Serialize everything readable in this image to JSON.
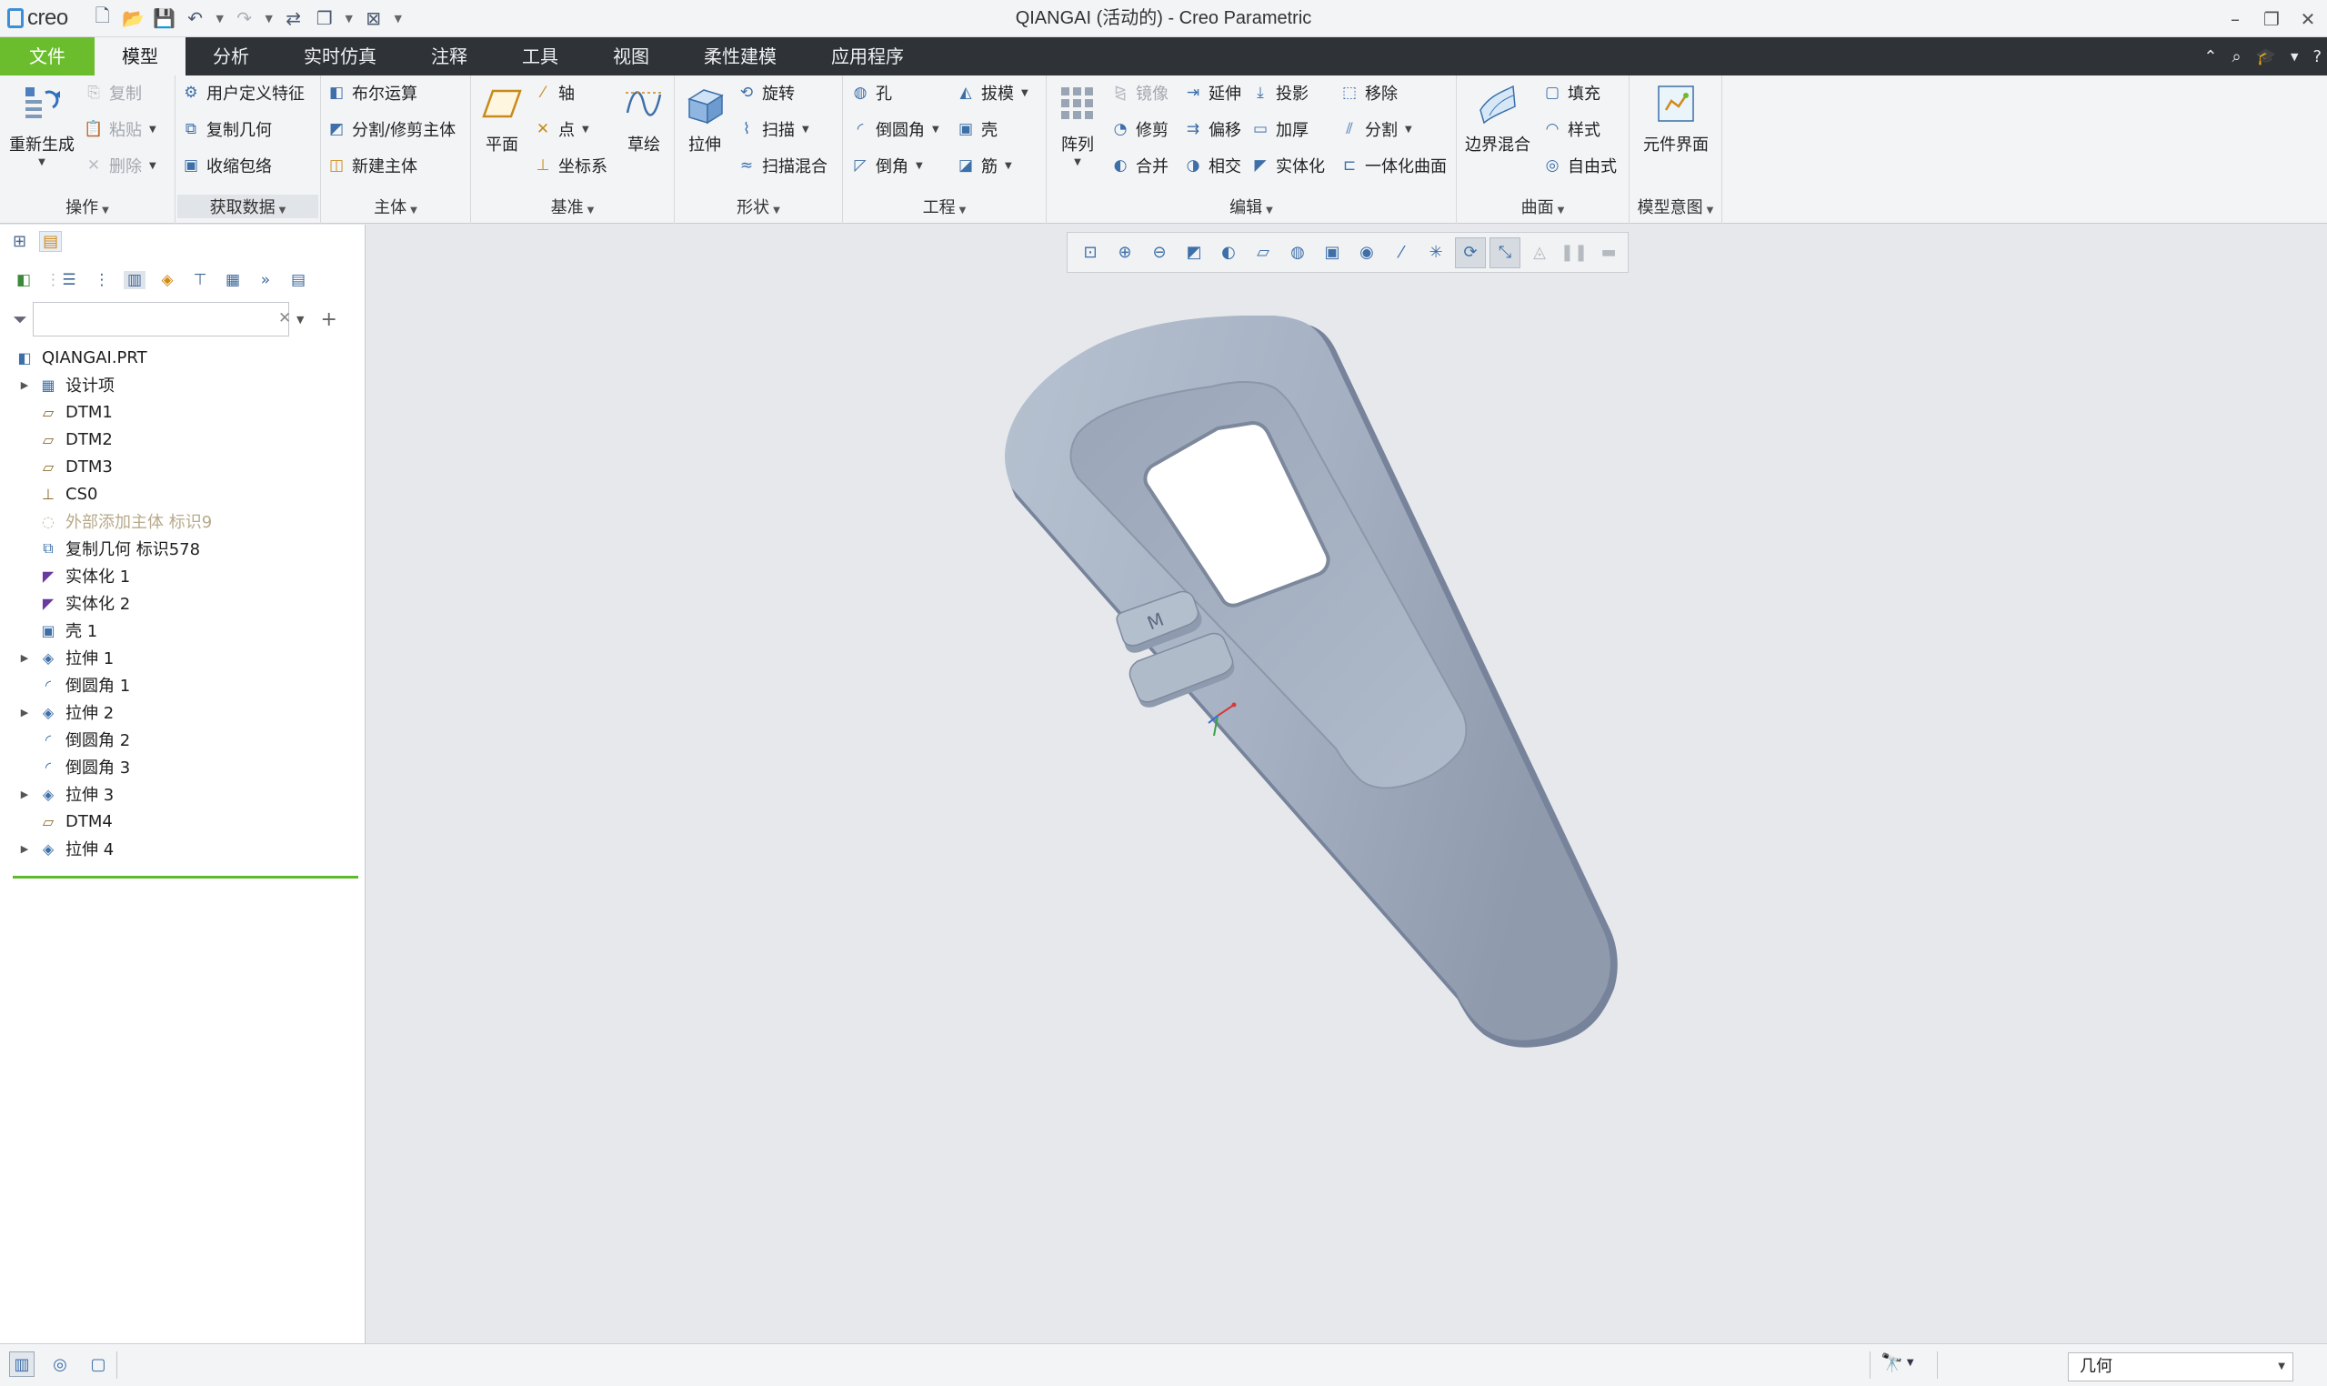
{
  "app": {
    "logo_text": "creo",
    "window_title": "QIANGAI (活动的) - Creo Parametric"
  },
  "tabs": [
    {
      "label": "文件"
    },
    {
      "label": "模型"
    },
    {
      "label": "分析"
    },
    {
      "label": "实时仿真"
    },
    {
      "label": "注释"
    },
    {
      "label": "工具"
    },
    {
      "label": "视图"
    },
    {
      "label": "柔性建模"
    },
    {
      "label": "应用程序"
    }
  ],
  "ribbon": {
    "operations": {
      "label": "操作",
      "regenerate": "重新生成",
      "copy": "复制",
      "paste": "粘贴",
      "delete": "删除"
    },
    "get_data": {
      "label": "获取数据",
      "udf": "用户定义特征",
      "copy_geom": "复制几何",
      "shrinkwrap": "收缩包络"
    },
    "body": {
      "label": "主体",
      "boolean": "布尔运算",
      "split_trim": "分割/修剪主体",
      "new_body": "新建主体"
    },
    "datum": {
      "label": "基准",
      "plane": "平面",
      "axis": "轴",
      "point": "点",
      "csys": "坐标系",
      "sketch": "草绘"
    },
    "shapes": {
      "label": "形状",
      "extrude": "拉伸",
      "revolve": "旋转",
      "sweep": "扫描",
      "swept_blend": "扫描混合"
    },
    "engineering": {
      "label": "工程",
      "hole": "孔",
      "round": "倒圆角",
      "chamfer": "倒角",
      "draft": "拔模",
      "shell": "壳",
      "rib": "筋"
    },
    "editing": {
      "label": "编辑",
      "pattern": "阵列",
      "mirror": "镜像",
      "extend": "延伸",
      "project": "投影",
      "remove": "移除",
      "trim": "修剪",
      "offset": "偏移",
      "thicken": "加厚",
      "split": "分割",
      "merge": "合并",
      "intersect": "相交",
      "solidify": "实体化",
      "unify_surface": "一体化曲面"
    },
    "surfaces": {
      "label": "曲面",
      "boundary_blend": "边界混合",
      "fill": "填充",
      "style": "样式",
      "freestyle": "自由式"
    },
    "model_intent": {
      "label": "模型意图",
      "component_interface": "元件界面"
    }
  },
  "model_tree": {
    "filter_placeholder": "",
    "items": [
      {
        "label": "QIANGAI.PRT",
        "icon": "part-icon",
        "expandable": false,
        "root": true,
        "dim": false
      },
      {
        "label": "设计项",
        "icon": "design-items-icon",
        "expandable": true,
        "root": false,
        "dim": false
      },
      {
        "label": "DTM1",
        "icon": "datum-plane-icon",
        "expandable": false,
        "root": false,
        "dim": false
      },
      {
        "label": "DTM2",
        "icon": "datum-plane-icon",
        "expandable": false,
        "root": false,
        "dim": false
      },
      {
        "label": "DTM3",
        "icon": "datum-plane-icon",
        "expandable": false,
        "root": false,
        "dim": false
      },
      {
        "label": "CS0",
        "icon": "csys-icon",
        "expandable": false,
        "root": false,
        "dim": false
      },
      {
        "label": "外部添加主体 标识9",
        "icon": "external-body-icon",
        "expandable": false,
        "root": false,
        "dim": true
      },
      {
        "label": "复制几何 标识578",
        "icon": "copy-geom-icon",
        "expandable": false,
        "root": false,
        "dim": false
      },
      {
        "label": "实体化 1",
        "icon": "solidify-icon",
        "expandable": false,
        "root": false,
        "dim": false
      },
      {
        "label": "实体化 2",
        "icon": "solidify-icon",
        "expandable": false,
        "root": false,
        "dim": false
      },
      {
        "label": "壳 1",
        "icon": "shell-icon",
        "expandable": false,
        "root": false,
        "dim": false
      },
      {
        "label": "拉伸 1",
        "icon": "extrude-icon",
        "expandable": true,
        "root": false,
        "dim": false
      },
      {
        "label": "倒圆角 1",
        "icon": "round-icon",
        "expandable": false,
        "root": false,
        "dim": false
      },
      {
        "label": "拉伸 2",
        "icon": "extrude-icon",
        "expandable": true,
        "root": false,
        "dim": false
      },
      {
        "label": "倒圆角 2",
        "icon": "round-icon",
        "expandable": false,
        "root": false,
        "dim": false
      },
      {
        "label": "倒圆角 3",
        "icon": "round-icon",
        "expandable": false,
        "root": false,
        "dim": false
      },
      {
        "label": "拉伸 3",
        "icon": "extrude-icon",
        "expandable": true,
        "root": false,
        "dim": false
      },
      {
        "label": "DTM4",
        "icon": "datum-plane-icon",
        "expandable": false,
        "root": false,
        "dim": false
      },
      {
        "label": "拉伸 4",
        "icon": "extrude-icon",
        "expandable": true,
        "root": false,
        "dim": false
      }
    ]
  },
  "model": {
    "button_glyph": "M",
    "color": "#a4b0c1"
  },
  "status": {
    "selection_filter": "几何"
  },
  "colors": {
    "file_tab": "#6bbd2d",
    "tab_bar": "#2f3236",
    "insert_line": "#5cba2c",
    "graphics_bg": "#e6e8ec"
  }
}
